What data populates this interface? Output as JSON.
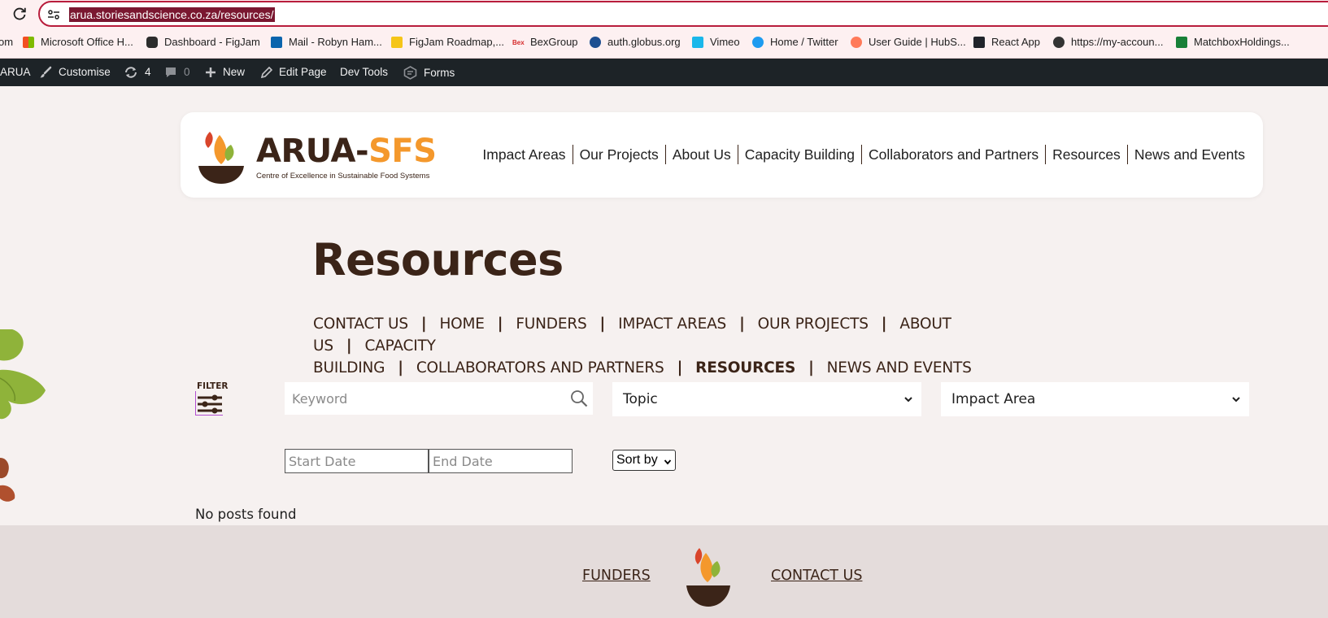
{
  "browser": {
    "url": "arua.storiesandscience.co.za/resources/"
  },
  "bookmarks": [
    {
      "label": "om",
      "color": "#fdf0f1"
    },
    {
      "label": "Microsoft Office H...",
      "color": "#f25022"
    },
    {
      "label": "Dashboard - FigJam",
      "color": "#2c2c2c"
    },
    {
      "label": "Mail - Robyn Ham...",
      "color": "#0a64ad"
    },
    {
      "label": "FigJam Roadmap,...",
      "color": "#f5c518"
    },
    {
      "label": "BexGroup",
      "color": "#d62b2b"
    },
    {
      "label": "auth.globus.org",
      "color": "#1d4f91"
    },
    {
      "label": "Vimeo",
      "color": "#1ab7ea"
    },
    {
      "label": "Home / Twitter",
      "color": "#1d9bf0"
    },
    {
      "label": "User Guide | HubS...",
      "color": "#ff7a59"
    },
    {
      "label": "React App",
      "color": "#20232a"
    },
    {
      "label": "https://my-accoun...",
      "color": "#333333"
    },
    {
      "label": "MatchboxHoldings...",
      "color": "#188038"
    }
  ],
  "adminbar": {
    "site": "ARUA",
    "customise": "Customise",
    "updates": "4",
    "comments": "0",
    "new": "New",
    "edit": "Edit Page",
    "devtools": "Dev Tools",
    "forms": "Forms"
  },
  "logo": {
    "name_a": "ARUA-",
    "name_b": "SFS",
    "tagline": "Centre of Excellence in Sustainable Food Systems"
  },
  "mainnav": [
    "Impact Areas",
    "Our Projects",
    "About Us",
    "Capacity Building",
    "Collaborators and Partners",
    "Resources",
    "News and Events"
  ],
  "page": {
    "title": "Resources"
  },
  "subnav": {
    "line1": [
      "Contact Us",
      "Home",
      "Funders",
      "Impact Areas",
      "Our Projects",
      "About Us",
      "Capacity"
    ],
    "line2": [
      "Building",
      "Collaborators and Partners",
      "Resources",
      "News and Events"
    ]
  },
  "filters": {
    "label": "FILTER",
    "keyword_placeholder": "Keyword",
    "topic": "Topic",
    "impact_area": "Impact Area",
    "start_date_placeholder": "Start Date",
    "end_date_placeholder": "End Date",
    "sort_by": "Sort by"
  },
  "results": {
    "empty": "No posts found"
  },
  "footer": {
    "funders": "FUNDERS",
    "contact": "CONTACT US"
  },
  "colors": {
    "brand_brown": "#3b2418",
    "brand_orange": "#f4982c",
    "brand_green": "#8fb33a",
    "brand_red": "#d9452b",
    "page_bg": "#f6f1f0",
    "footer_bg": "#e4dcdb"
  }
}
